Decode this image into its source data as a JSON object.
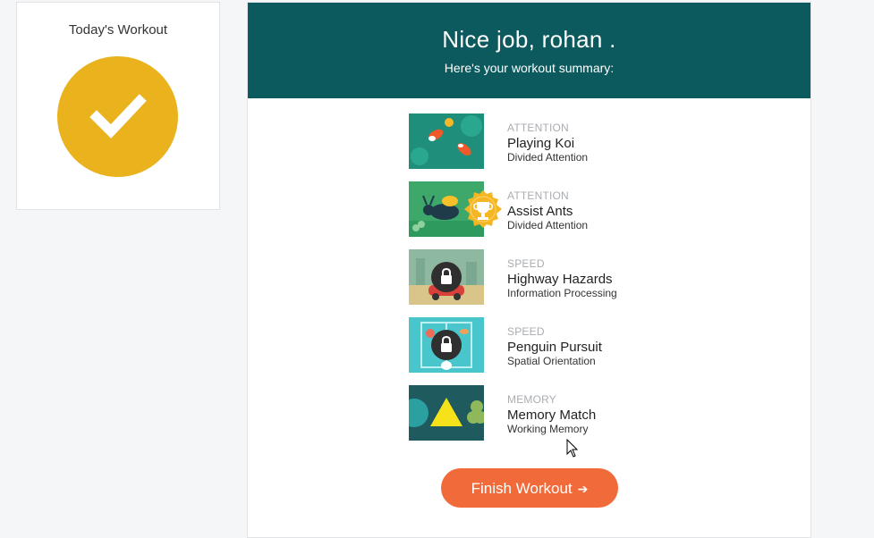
{
  "today_card": {
    "title": "Today's Workout",
    "status_icon": "checkmark-icon",
    "accent": "#eab21c"
  },
  "header": {
    "title": "Nice job, rohan .",
    "subtitle": "Here's your workout summary:",
    "background": "#0d5a5e"
  },
  "games": [
    {
      "category": "ATTENTION",
      "name": "Playing Koi",
      "skill": "Divided Attention",
      "status": "completed",
      "icon": "koi-thumbnail"
    },
    {
      "category": "ATTENTION",
      "name": "Assist Ants",
      "skill": "Divided Attention",
      "status": "trophy",
      "icon": "trophy-icon"
    },
    {
      "category": "SPEED",
      "name": "Highway Hazards",
      "skill": "Information Processing",
      "status": "locked",
      "icon": "lock-icon"
    },
    {
      "category": "SPEED",
      "name": "Penguin Pursuit",
      "skill": "Spatial Orientation",
      "status": "locked",
      "icon": "lock-icon"
    },
    {
      "category": "MEMORY",
      "name": "Memory Match",
      "skill": "Working Memory",
      "status": "completed",
      "icon": "memory-thumbnail"
    }
  ],
  "finish_button": {
    "label": "Finish Workout",
    "arrow": "➔",
    "color": "#f06a3a"
  }
}
